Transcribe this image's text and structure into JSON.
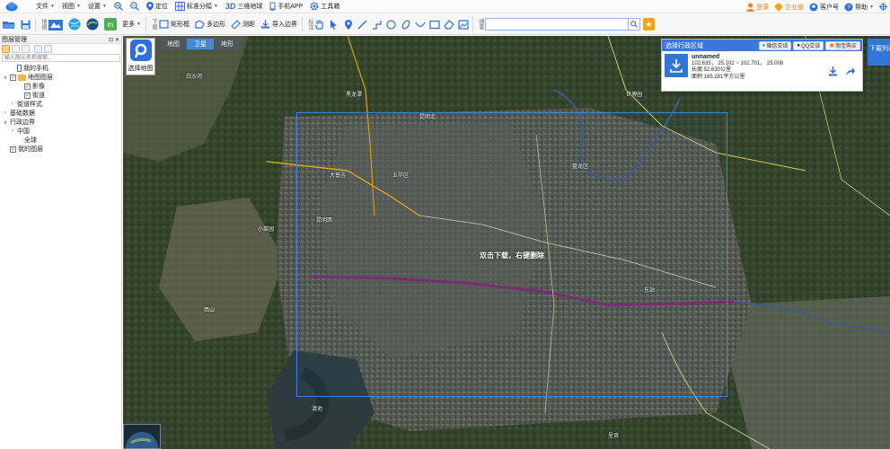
{
  "menubar": {
    "file": "文件",
    "view": "视图",
    "settings": "设置",
    "locate": "定位",
    "tile_standard": "标准分幅",
    "threed_earth": "三维地球",
    "mobile_app": "手机APP",
    "toolbox": "工具箱",
    "login": "登录",
    "enterprise": "企业版",
    "customer": "客户号",
    "help": "帮助"
  },
  "toolbar": {
    "group_map": "地图",
    "more": "更多",
    "group_download": "下载",
    "rectangle": "矩形框",
    "polygon": "多边形",
    "measure": "测距",
    "import_boundary": "导入边界",
    "group_draw": "标注",
    "group_search": "搜索",
    "search_value": ""
  },
  "left_panel": {
    "title": "图层管理",
    "search_placeholder": "输入图元名称搜索...",
    "tree": [
      {
        "label": "我的手机",
        "level": 1,
        "type": "phone"
      },
      {
        "label": "地图图层",
        "level": 0,
        "type": "folder",
        "expanded": true
      },
      {
        "label": "影像",
        "level": 2,
        "type": "check",
        "checked": true
      },
      {
        "label": "街道",
        "level": 2,
        "type": "check",
        "checked": true
      },
      {
        "label": "街道样式",
        "level": 1,
        "type": "collapsed"
      },
      {
        "label": "基础数据",
        "level": 0,
        "type": "collapsed"
      },
      {
        "label": "行政边界",
        "level": 0,
        "type": "expanded"
      },
      {
        "label": "中国",
        "level": 1,
        "type": "collapsed"
      },
      {
        "label": "全球",
        "level": 2,
        "type": "none"
      },
      {
        "label": "我的图层",
        "level": 0,
        "type": "check",
        "checked": true
      }
    ]
  },
  "map": {
    "tabs": [
      "地图",
      "卫星",
      "地形"
    ],
    "active_tab": "卫星",
    "choose_map_label": "选择地图",
    "hint": "双击下载，右键删除",
    "labels": [
      "黑龙潭",
      "昆明北",
      "白沙河",
      "昆明西",
      "大普吉",
      "小菜园",
      "西山",
      "世博园",
      "五华区",
      "盘龙区",
      "东站",
      "滇池",
      "呈贡"
    ],
    "colors": {
      "selection": "#3d7fe0",
      "metro": "#7b2a6e",
      "highway": "#f0b400"
    }
  },
  "info_panel": {
    "title": "选择行政区域",
    "wechat": "微信交谈",
    "qq": "QQ交谈",
    "taobao": "淘宝购买",
    "name": "unnamed",
    "coords": "102.635， 25.102 ~ 102.701， 25.008",
    "perimeter": "长度:52.630公里",
    "area": "面积:165.281平方公里"
  },
  "download_list": "下载列表"
}
